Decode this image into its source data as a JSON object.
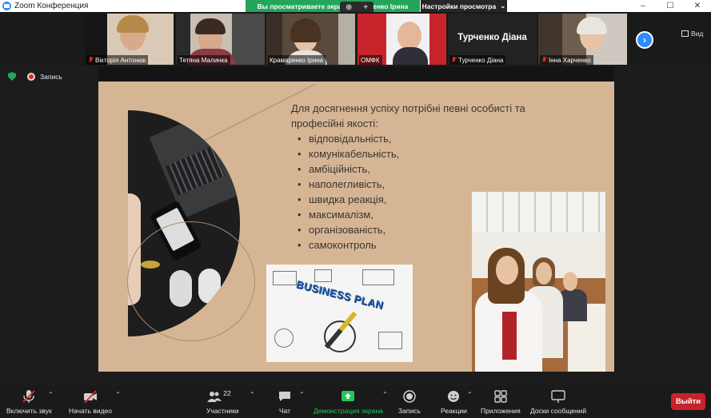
{
  "window": {
    "title": "Zoom Конференция",
    "controls": [
      "–",
      "☐",
      "✕"
    ]
  },
  "share_banner": {
    "text": "Вы просматриваете экран Крамаренко Ірина",
    "view_options": "Настройки просмотра"
  },
  "gallery": {
    "participants": [
      {
        "name": "Вікторія Антонюк",
        "muted": true
      },
      {
        "name": "Тетяна Малинка",
        "muted": false
      },
      {
        "name": "Крамаренко Ірина",
        "muted": false,
        "active": true
      },
      {
        "name": "ОМФК",
        "muted": false
      },
      {
        "name": "Турченко Діана",
        "muted": true,
        "video": false
      },
      {
        "name": "Інна Харченко",
        "muted": true
      }
    ],
    "next_label": "›",
    "view_label": "Вид"
  },
  "recording": {
    "label": "Запись"
  },
  "slide": {
    "intro": "Для досягнення успіху потрібні певні особисті та професійні якості:",
    "qualities": [
      "відповідальність,",
      "комунікабельність,",
      "амбіційність,",
      "наполегливість,",
      "швидка реакція,",
      "максималізм,",
      "організованість,",
      "самоконтроль"
    ],
    "image_text": "BUSINESS PLAN"
  },
  "toolbar": {
    "unmute": "Включить звук",
    "start_video": "Начать видео",
    "participants": "Участники",
    "participants_count": "22",
    "chat": "Чат",
    "share_screen": "Демонстрация экрана",
    "record": "Запись",
    "reactions": "Реакции",
    "apps": "Приложения",
    "whiteboards": "Доски сообщений",
    "leave": "Выйти"
  },
  "colors": {
    "zoom_blue": "#2d8cff",
    "share_green": "#23a55a",
    "leave_red": "#c8232c",
    "slide_bg": "#d6b595"
  }
}
